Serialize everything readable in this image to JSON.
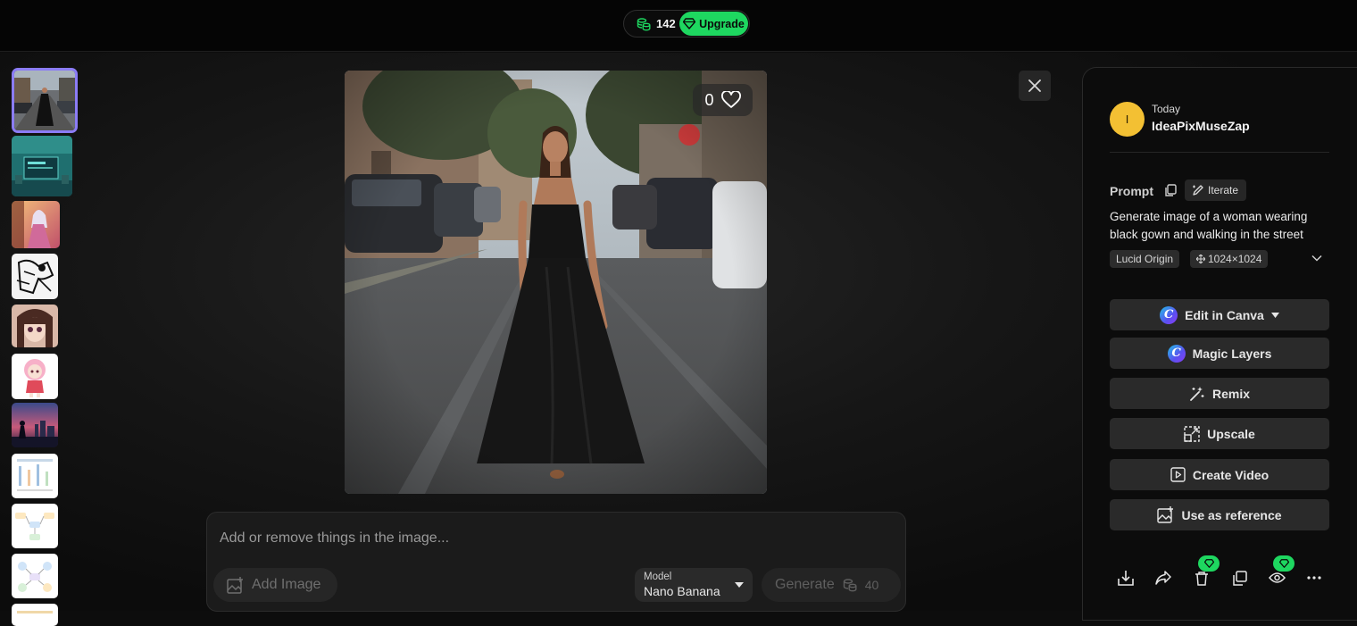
{
  "topbar": {
    "credits": "142",
    "upgrade_label": "Upgrade",
    "accent_color": "#1ed760"
  },
  "viewer": {
    "like_count": "0",
    "thumbnails": [
      "woman-black-gown",
      "teal-computer-room",
      "fantasy-girl-sunset",
      "manga-sketch",
      "anime-girl-portrait",
      "chibi-pink-girl",
      "city-night-figure",
      "diagram-page-1",
      "diagram-page-2",
      "diagram-page-3"
    ]
  },
  "editor": {
    "placeholder": "Add or remove things in the image...",
    "add_image_label": "Add Image",
    "model_label": "Model",
    "model_value": "Nano Banana",
    "generate_label": "Generate",
    "generate_cost": "40"
  },
  "panel": {
    "avatar_initial": "I",
    "date": "Today",
    "username": "IdeaPixMuseZap",
    "prompt_label": "Prompt",
    "iterate_label": "Iterate",
    "prompt_text": "Generate image of a woman wearing black gown and walking in the street",
    "model_tag": "Lucid Origin",
    "size_tag": "1024×1024",
    "actions": {
      "edit_canva": "Edit in Canva",
      "magic_layers": "Magic Layers",
      "remix": "Remix",
      "upscale": "Upscale",
      "create_video": "Create Video",
      "use_reference": "Use as reference"
    }
  }
}
